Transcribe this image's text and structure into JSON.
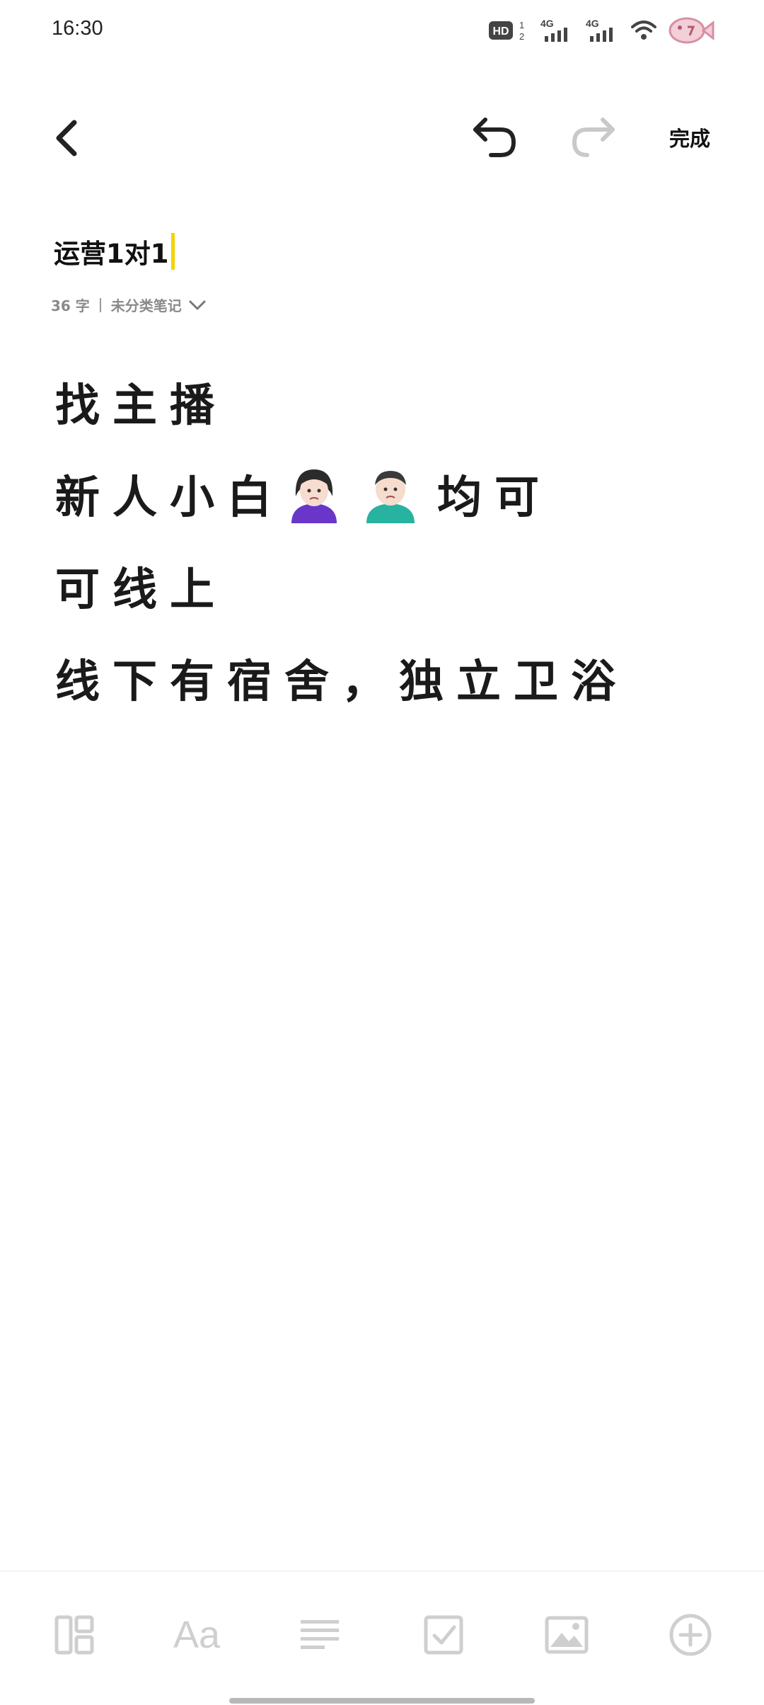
{
  "status_bar": {
    "time": "16:30",
    "icons": [
      "hd-voice-icon",
      "signal-4g-icon",
      "signal-4g-icon",
      "wifi-icon",
      "fish-app-icon"
    ],
    "hd_label": "HD",
    "hd_sub": "1",
    "hd_sub2": "2",
    "sim1": "4G",
    "sim2": "4G"
  },
  "toolbar": {
    "back_icon": "back-icon",
    "undo_icon": "undo-icon",
    "redo_icon": "redo-icon",
    "done_label": "完成"
  },
  "note": {
    "title": "运营1对1",
    "word_count": "36 字",
    "category": "未分类笔记",
    "lines": [
      {
        "text_before": "找主播",
        "emojis": [],
        "text_after": ""
      },
      {
        "text_before": "新人小白",
        "emojis": [
          "woman-shrugging-emoji",
          "man-shrugging-emoji"
        ],
        "text_after": "均可"
      },
      {
        "text_before": "可线上",
        "emojis": [],
        "text_after": ""
      },
      {
        "text_before": "线下有宿舍，独立卫浴",
        "emojis": [],
        "text_after": ""
      }
    ]
  },
  "bottom_toolbar": {
    "items": [
      "layout-icon",
      "font-style-icon",
      "paragraph-icon",
      "checkbox-icon",
      "image-icon",
      "add-icon"
    ],
    "font_label": "Aa"
  },
  "colors": {
    "caret": "#f5d400",
    "text": "#1a1a1a",
    "muted": "#8a8a8a",
    "toolbar_icon": "#cfcfcf"
  }
}
